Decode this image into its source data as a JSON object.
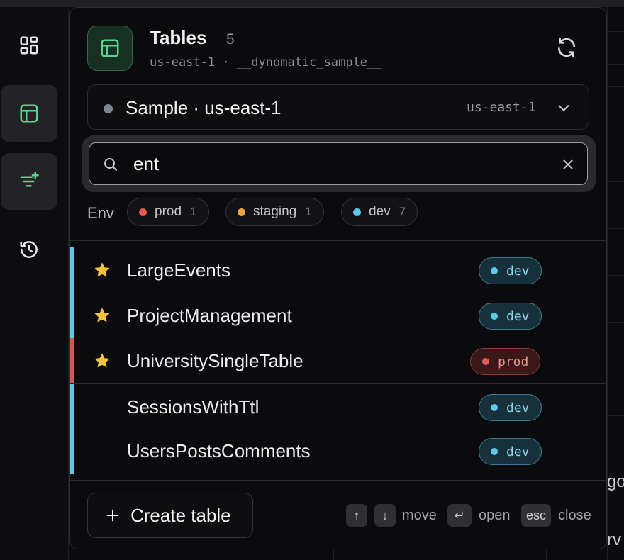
{
  "app": {
    "background_partial_text": [
      "go",
      "rv"
    ]
  },
  "rail": {
    "items": [
      {
        "icon": "dashboard-icon",
        "active": false
      },
      {
        "icon": "tables-icon",
        "active": true
      },
      {
        "icon": "filter-add-icon",
        "active": true
      },
      {
        "icon": "history-icon",
        "active": false
      }
    ]
  },
  "panel": {
    "title": "Tables",
    "count": "5",
    "subtitle": "us-east-1 · __dynomatic_sample__",
    "connection": {
      "label": "Sample · us-east-1",
      "region": "us-east-1",
      "status_color": "#7d8590"
    },
    "search": {
      "value": "ent",
      "placeholder": ""
    },
    "env_filter": {
      "label": "Env",
      "chips": [
        {
          "name": "prod",
          "count": "1",
          "color": "#e35b56"
        },
        {
          "name": "staging",
          "count": "1",
          "color": "#e8a33d"
        },
        {
          "name": "dev",
          "count": "7",
          "color": "#5cc9e8"
        }
      ]
    },
    "favorites": [
      {
        "name": "LargeEvents",
        "env": "dev"
      },
      {
        "name": "ProjectManagement",
        "env": "dev"
      },
      {
        "name": "UniversitySingleTable",
        "env": "prod"
      }
    ],
    "tables": [
      {
        "name": "SessionsWithTtl",
        "env": "dev"
      },
      {
        "name": "UsersPostsComments",
        "env": "dev"
      }
    ],
    "footer": {
      "create_label": "Create table",
      "hints": {
        "up_key": "↑",
        "down_key": "↓",
        "move": "move",
        "enter_key": "↵",
        "open": "open",
        "esc_key": "esc",
        "close": "close"
      }
    }
  },
  "colors": {
    "accent_green": "#5fd38d",
    "dev": "#5cc9e8",
    "prod": "#e35b56",
    "staging": "#e8a33d",
    "star": "#f5c33b"
  }
}
